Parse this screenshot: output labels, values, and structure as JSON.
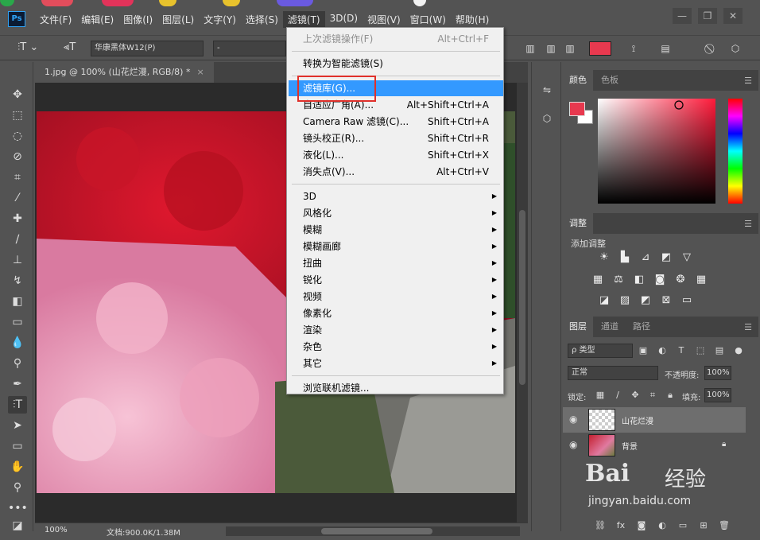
{
  "app": {
    "logo": "Ps"
  },
  "menubar": {
    "items": [
      "文件(F)",
      "编辑(E)",
      "图像(I)",
      "图层(L)",
      "文字(Y)",
      "选择(S)",
      "滤镜(T)",
      "3D(D)",
      "视图(V)",
      "窗口(W)",
      "帮助(H)"
    ],
    "active_index": 6,
    "window_controls": [
      "—",
      "❐",
      "✕"
    ]
  },
  "options_bar": {
    "font_family": "华康黑体W12(P)",
    "font_style": "-",
    "text_color": "#e8394f"
  },
  "document_tab": {
    "title": "1.jpg @ 100% (山花烂漫, RGB/8) *",
    "close": "×"
  },
  "status_bar": {
    "zoom": "100%",
    "doc_info": "文档:900.0K/1.38M"
  },
  "filter_menu": {
    "items": [
      {
        "label": "上次滤镜操作(F)",
        "shortcut": "Alt+Ctrl+F",
        "disabled": true
      },
      {
        "sep": true
      },
      {
        "label": "转换为智能滤镜(S)",
        "shortcut": ""
      },
      {
        "sep": true
      },
      {
        "label": "滤镜库(G)...",
        "shortcut": "",
        "highlight": true
      },
      {
        "label": "自适应广角(A)...",
        "shortcut": "Alt+Shift+Ctrl+A"
      },
      {
        "label": "Camera Raw 滤镜(C)...",
        "shortcut": "Shift+Ctrl+A"
      },
      {
        "label": "镜头校正(R)...",
        "shortcut": "Shift+Ctrl+R"
      },
      {
        "label": "液化(L)...",
        "shortcut": "Shift+Ctrl+X"
      },
      {
        "label": "消失点(V)...",
        "shortcut": "Alt+Ctrl+V"
      },
      {
        "sep": true
      },
      {
        "label": "3D",
        "submenu": true
      },
      {
        "label": "风格化",
        "submenu": true
      },
      {
        "label": "模糊",
        "submenu": true
      },
      {
        "label": "模糊画廊",
        "submenu": true
      },
      {
        "label": "扭曲",
        "submenu": true
      },
      {
        "label": "锐化",
        "submenu": true
      },
      {
        "label": "视频",
        "submenu": true
      },
      {
        "label": "像素化",
        "submenu": true
      },
      {
        "label": "渲染",
        "submenu": true
      },
      {
        "label": "杂色",
        "submenu": true
      },
      {
        "label": "其它",
        "submenu": true
      },
      {
        "sep": true
      },
      {
        "label": "浏览联机滤镜...",
        "shortcut": ""
      }
    ]
  },
  "color_panel": {
    "tabs": [
      "颜色",
      "色板"
    ],
    "foreground": "#e8394f",
    "background": "#ffffff"
  },
  "adjust_panel": {
    "tab": "调整",
    "title": "添加调整"
  },
  "layers_panel": {
    "tabs": [
      "图层",
      "通道",
      "路径"
    ],
    "filter_kind": "ρ 类型",
    "blend_mode": "正常",
    "opacity_label": "不透明度:",
    "opacity": "100%",
    "lock_label": "锁定:",
    "fill_label": "填充:",
    "fill": "100%",
    "layers": [
      {
        "name": "山花烂漫",
        "selected": true
      },
      {
        "name": "背景",
        "locked": true
      }
    ]
  },
  "watermark": {
    "brand_a": "Bai",
    "brand_b": "经验",
    "url": "jingyan.baidu.com"
  }
}
